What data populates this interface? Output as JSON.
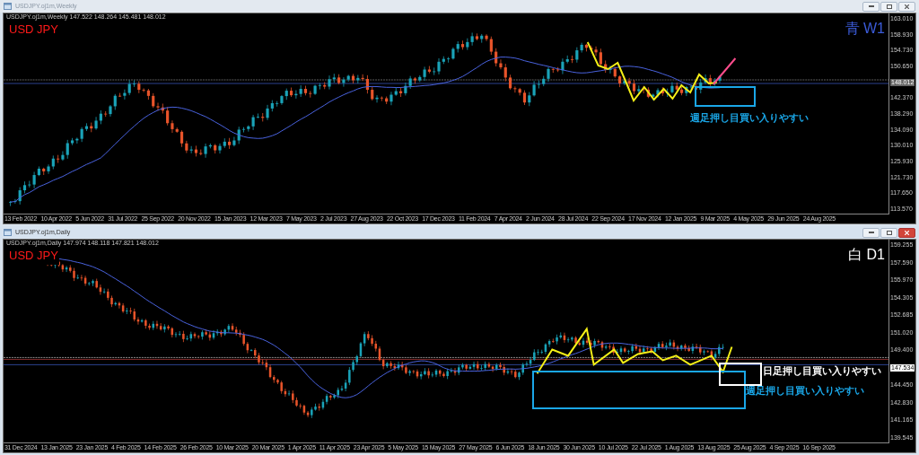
{
  "windows": [
    {
      "title": "USDJPY.oj1m,Weekly",
      "active": false,
      "info": "USDJPY.oj1m,Weekly  147.522 148.264 145.481 148.012",
      "symbol_label": "USD JPY",
      "timeframe": {
        "label": "青 W1",
        "color": "#3b5bd8"
      },
      "notes": [
        {
          "text": "週足押し目買い入りやすい",
          "kind": "weekly"
        }
      ],
      "price_axis": [
        {
          "text": "163.010",
          "kind": "tick"
        },
        {
          "text": "158.930",
          "kind": "tick"
        },
        {
          "text": "154.730",
          "kind": "tick"
        },
        {
          "text": "150.650",
          "kind": "tick"
        },
        {
          "text": "148.012",
          "kind": "grey"
        },
        {
          "text": "142.370",
          "kind": "tick"
        },
        {
          "text": "138.290",
          "kind": "tick"
        },
        {
          "text": "134.090",
          "kind": "tick"
        },
        {
          "text": "130.010",
          "kind": "tick"
        },
        {
          "text": "125.930",
          "kind": "tick"
        },
        {
          "text": "121.730",
          "kind": "tick"
        },
        {
          "text": "117.650",
          "kind": "tick"
        },
        {
          "text": "113.570",
          "kind": "tick"
        }
      ],
      "dates": [
        "13 Feb 2022",
        "10 Apr 2022",
        "5 Jun 2022",
        "31 Jul 2022",
        "25 Sep 2022",
        "20 Nov 2022",
        "15 Jan 2023",
        "12 Mar 2023",
        "7 May 2023",
        "2 Jul 2023",
        "27 Aug 2023",
        "22 Oct 2023",
        "17 Dec 2023",
        "11 Feb 2024",
        "7 Apr 2024",
        "2 Jun 2024",
        "28 Jul 2024",
        "22 Sep 2024",
        "17 Nov 2024",
        "12 Jan 2025",
        "9 Mar 2025",
        "4 May 2025",
        "29 Jun 2025",
        "24 Aug 2025"
      ]
    },
    {
      "title": "USDJPY.oj1m,Daily",
      "active": true,
      "info": "USDJPY.oj1m,Daily  147.974 148.118 147.821 148.012",
      "symbol_label": "USD JPY",
      "timeframe": {
        "label": "白 D1",
        "color": "#ffffff"
      },
      "notes": [
        {
          "text": "日足押し目買い入りやすい",
          "kind": "daily"
        },
        {
          "text": "週足押し目買い入りやすい",
          "kind": "weekly"
        }
      ],
      "price_axis": [
        {
          "text": "159.255",
          "kind": "tick"
        },
        {
          "text": "157.590",
          "kind": "tick"
        },
        {
          "text": "155.970",
          "kind": "tick"
        },
        {
          "text": "154.305",
          "kind": "tick"
        },
        {
          "text": "152.685",
          "kind": "tick"
        },
        {
          "text": "151.020",
          "kind": "tick"
        },
        {
          "text": "149.400",
          "kind": "tick"
        },
        {
          "text": "147.534",
          "kind": "white"
        },
        {
          "text": "144.450",
          "kind": "tick"
        },
        {
          "text": "142.830",
          "kind": "tick"
        },
        {
          "text": "141.165",
          "kind": "tick"
        },
        {
          "text": "139.545",
          "kind": "tick"
        }
      ],
      "dates": [
        "31 Dec 2024",
        "13 Jan 2025",
        "23 Jan 2025",
        "4 Feb 2025",
        "14 Feb 2025",
        "26 Feb 2025",
        "10 Mar 2025",
        "20 Mar 2025",
        "1 Apr 2025",
        "11 Apr 2025",
        "23 Apr 2025",
        "5 May 2025",
        "15 May 2025",
        "27 May 2025",
        "6 Jun 2025",
        "18 Jun 2025",
        "30 Jun 2025",
        "10 Jul 2025",
        "22 Jul 2025",
        "1 Aug 2025",
        "13 Aug 2025",
        "25 Aug 2025",
        "4 Sep 2025",
        "16 Sep 2025"
      ]
    }
  ]
}
